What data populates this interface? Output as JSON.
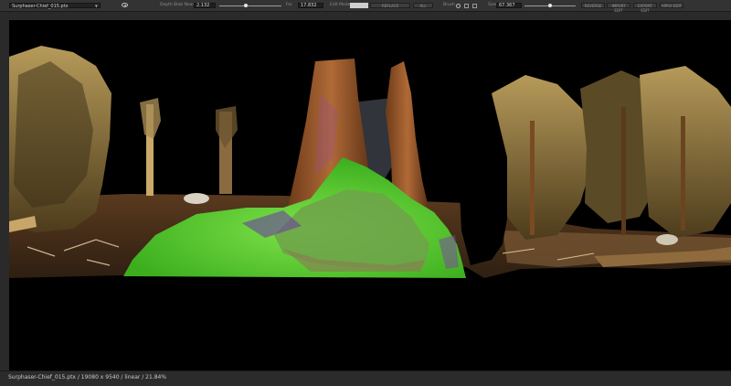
{
  "toolbar": {
    "file_name": "Surphaser-Chief_015.ptx",
    "depth_near_label": "Depth Blob Near",
    "depth_near_value": "2.132",
    "depth_near_level": 0.42,
    "far_label": "Far",
    "far_value": "17.832",
    "edit_mode_label": "Edit Mode",
    "replace_label": "REPLACE",
    "all_label": "ALL",
    "brush_label": "Brush",
    "size_label": "Size",
    "size_value": "67.367",
    "size_level": 0.5,
    "buttons": [
      "REVERSE",
      "IMPORT EDIT",
      "EXPORT EDIT",
      "APPLY EDIT"
    ]
  },
  "status": {
    "text": "Surphaser-Chief_015.ptx  /  19080 x 9540  /  linear  /  21.84%"
  },
  "colors": {
    "toolbar_bg": "#333333",
    "viewport_bg": "#000000",
    "highlight_green": "#5bd32a",
    "trunk_brown": "#9a5a2a"
  }
}
